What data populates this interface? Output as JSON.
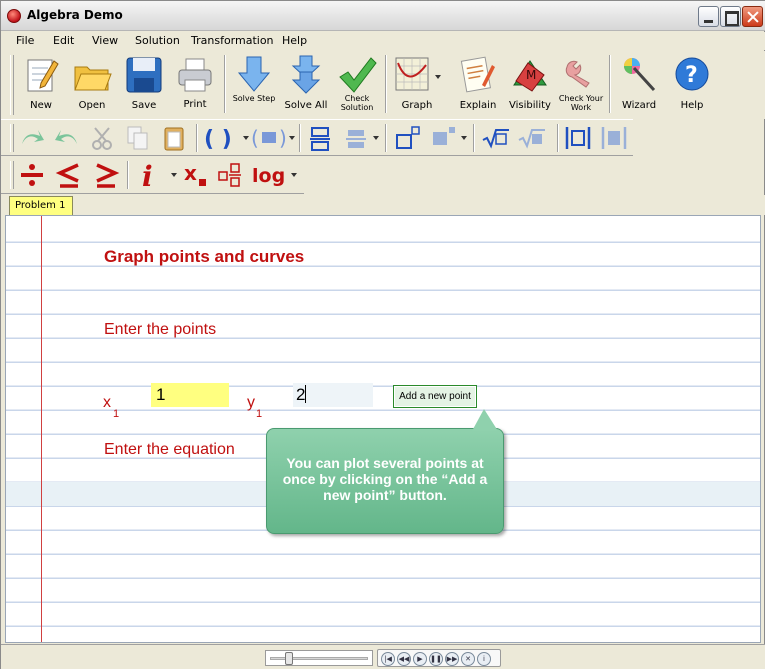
{
  "window": {
    "title": "Algebra Demo"
  },
  "menu": [
    "File",
    "Edit",
    "View",
    "Solution",
    "Transformation",
    "Help"
  ],
  "toolbar": {
    "new": "New",
    "open": "Open",
    "save": "Save",
    "print": "Print",
    "solve_step": "Solve Step",
    "solve_all": "Solve All",
    "check_solution": "Check Solution",
    "graph": "Graph",
    "explain": "Explain",
    "visibility": "Visibility",
    "check_your_work": "Check Your Work",
    "wizard": "Wizard",
    "help": "Help"
  },
  "tabs": [
    {
      "label": "Problem 1",
      "active": true
    }
  ],
  "problem": {
    "title": "Graph points and curves",
    "points_label": "Enter the points",
    "x_label": "x",
    "x_sub": "1",
    "x_value": "1",
    "y_label": "y",
    "y_sub": "1",
    "y_value": "2",
    "add_point_button": "Add a new point",
    "equation_label": "Enter the equation"
  },
  "tooltip": {
    "text": "You can plot several points at once by clicking on the “Add a new point” button."
  },
  "colors": {
    "accent_red": "#c01010",
    "tooltip_green": "#7cc39b",
    "field_yellow": "#ffff80"
  }
}
